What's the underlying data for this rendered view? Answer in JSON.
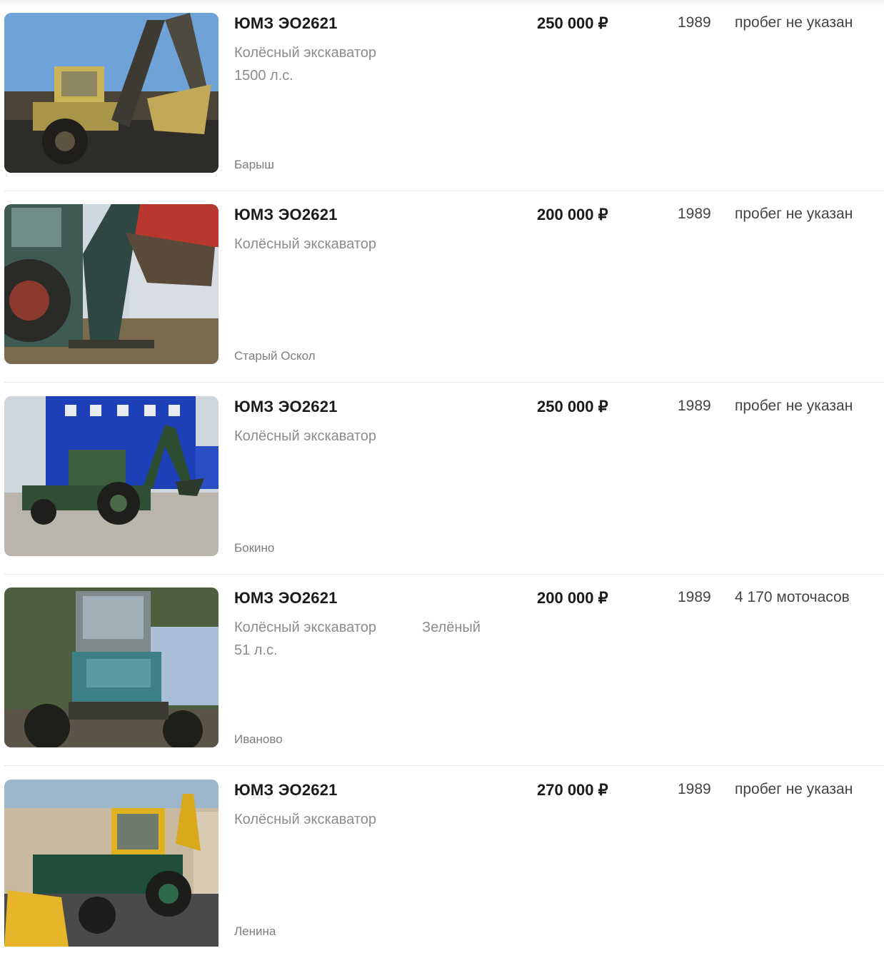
{
  "listings": [
    {
      "title": "ЮМЗ ЭО2621",
      "type": "Колёсный экскаватор",
      "color": "",
      "power": "1500 л.с.",
      "city": "Барыш",
      "price": "250 000 ₽",
      "year": "1989",
      "mileage": "пробег не указан",
      "photo_icon": "excavator-photo-icon"
    },
    {
      "title": "ЮМЗ ЭО2621",
      "type": "Колёсный экскаватор",
      "color": "",
      "power": "",
      "city": "Старый Оскол",
      "price": "200 000 ₽",
      "year": "1989",
      "mileage": "пробег не указан",
      "photo_icon": "excavator-photo-icon"
    },
    {
      "title": "ЮМЗ ЭО2621",
      "type": "Колёсный экскаватор",
      "color": "",
      "power": "",
      "city": "Бокино",
      "price": "250 000 ₽",
      "year": "1989",
      "mileage": "пробег не указан",
      "photo_icon": "excavator-photo-icon"
    },
    {
      "title": "ЮМЗ ЭО2621",
      "type": "Колёсный экскаватор",
      "color": "Зелёный",
      "power": "51 л.с.",
      "city": "Иваново",
      "price": "200 000 ₽",
      "year": "1989",
      "mileage": "4 170 моточасов",
      "photo_icon": "excavator-photo-icon"
    },
    {
      "title": "ЮМЗ ЭО2621",
      "type": "Колёсный экскаватор",
      "color": "",
      "power": "",
      "city": "Ленина",
      "price": "270 000 ₽",
      "year": "1989",
      "mileage": "пробег не указан",
      "photo_icon": "excavator-photo-icon"
    }
  ],
  "colors": {
    "title": "#1a1a1a",
    "secondary_text": "#8c8c8c",
    "separator": "#e6e6e6"
  }
}
